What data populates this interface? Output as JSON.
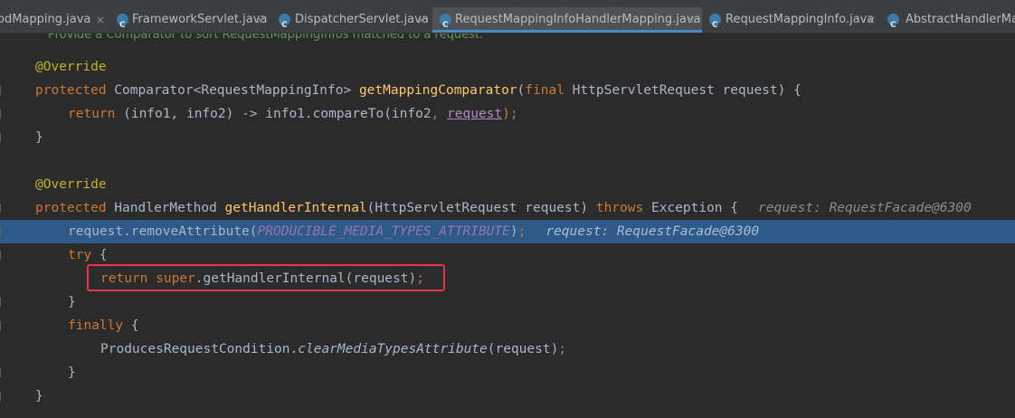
{
  "tabs": [
    {
      "label": "odMapping.java",
      "active": false,
      "has_icon": false
    },
    {
      "label": "FrameworkServlet.java",
      "active": false,
      "has_icon": true
    },
    {
      "label": "DispatcherServlet.java",
      "active": false,
      "has_icon": true
    },
    {
      "label": "RequestMappingInfoHandlerMapping.java",
      "active": true,
      "has_icon": true
    },
    {
      "label": "RequestMappingInfo.java",
      "active": false,
      "has_icon": true
    },
    {
      "label": "AbstractHandlerMap",
      "active": false,
      "has_icon": true
    }
  ],
  "close_glyph": "×",
  "doc_comment": "Provide a Comparator to sort RequestMappingInfos matched to a request.",
  "code": {
    "l1": "@Override",
    "l2": {
      "kw": "protected",
      "type": " Comparator<RequestMappingInfo> ",
      "method": "getMappingComparator",
      "paren": "(",
      "final": "final",
      "rest": " HttpServletRequest request) {"
    },
    "l3": {
      "ret": "return",
      "a": " (info1, info2) -> info1.compareTo(info2",
      "comma": ",",
      "sp": " ",
      "param": "request",
      "end": ");"
    },
    "l4": "}",
    "l6": "@Override",
    "l7": {
      "kw": "protected",
      "type": " HandlerMethod ",
      "method": "getHandlerInternal",
      "args": "(HttpServletRequest request) ",
      "throws": "throws",
      "rest": " Exception {",
      "hint": "request: RequestFacade@6300"
    },
    "l8": {
      "a": "request.removeAttribute(",
      "const": "PRODUCIBLE_MEDIA_TYPES_ATTRIBUTE",
      "b": ")",
      "semi": ";",
      "hint": "request: RequestFacade@6300"
    },
    "l9": {
      "kw": "try",
      "rest": " {"
    },
    "l10": {
      "ret": "return",
      "sup": " super",
      "rest": ".getHandlerInternal(request)",
      "semi": ";"
    },
    "l11": "}",
    "l12": {
      "kw": "finally",
      "rest": " {"
    },
    "l13": {
      "a": "ProducesRequestCondition.",
      "static": "clearMediaTypesAttribute",
      "b": "(request)",
      "semi": ";"
    },
    "l14": "}",
    "l15": "}"
  },
  "colors": {
    "editor_bg": "#2b2b2b",
    "keyword": "#cc7832",
    "annotation": "#bbb529",
    "method": "#ffc66d",
    "constant": "#9876aa",
    "highlight_line": "#2d5a88",
    "callout_border": "#e8334a"
  }
}
